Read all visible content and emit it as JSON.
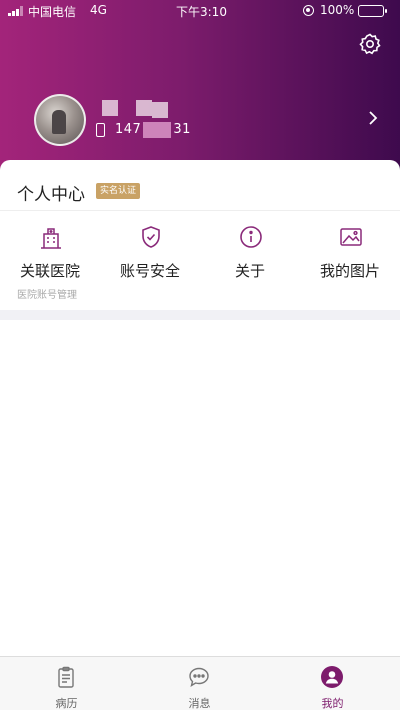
{
  "status_bar": {
    "carrier": "中国电信",
    "network": "4G",
    "time": "下午3:10",
    "battery_pct": "100%"
  },
  "profile": {
    "phone_start": "147",
    "phone_end": "31"
  },
  "card": {
    "title": "个人中心",
    "badge": "实名认证",
    "menu": [
      {
        "label": "关联医院",
        "icon": "hospital-building-icon",
        "sub": "医院账号管理"
      },
      {
        "label": "账号安全",
        "icon": "shield-check-icon"
      },
      {
        "label": "关于",
        "icon": "info-icon"
      },
      {
        "label": "我的图片",
        "icon": "image-icon"
      }
    ]
  },
  "tabbar": [
    {
      "label": "病历",
      "icon": "clipboard-icon",
      "active": false
    },
    {
      "label": "消息",
      "icon": "chat-bubble-icon",
      "active": false
    },
    {
      "label": "我的",
      "icon": "person-icon",
      "active": true
    }
  ],
  "colors": {
    "accent": "#7d1c6c",
    "badge": "#c9a265",
    "gradient_start": "#a3247a",
    "gradient_end": "#3e0a4d"
  }
}
